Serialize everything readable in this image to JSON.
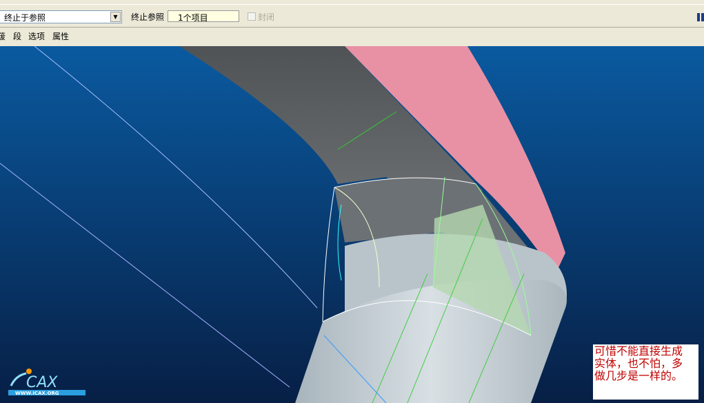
{
  "toolbar": {
    "dropdown_value": "终止于参照",
    "ref_label": "终止参照",
    "ref_value": "1个项目",
    "closed_label": "封闭"
  },
  "tabs": [
    "菝",
    "段",
    "选项",
    "属性"
  ],
  "note": {
    "lines": [
      "可惜不能直接生成",
      "实体，也不怕，多",
      "做几步是一样的。"
    ]
  },
  "logo": {
    "text": "ICAX",
    "url_text": "WWW.ICAX.ORG"
  },
  "colors": {
    "background_top": "#0a5aa0",
    "background_bottom": "#08244a",
    "surface": "#c8d2d8",
    "pink": "#e891a5"
  }
}
